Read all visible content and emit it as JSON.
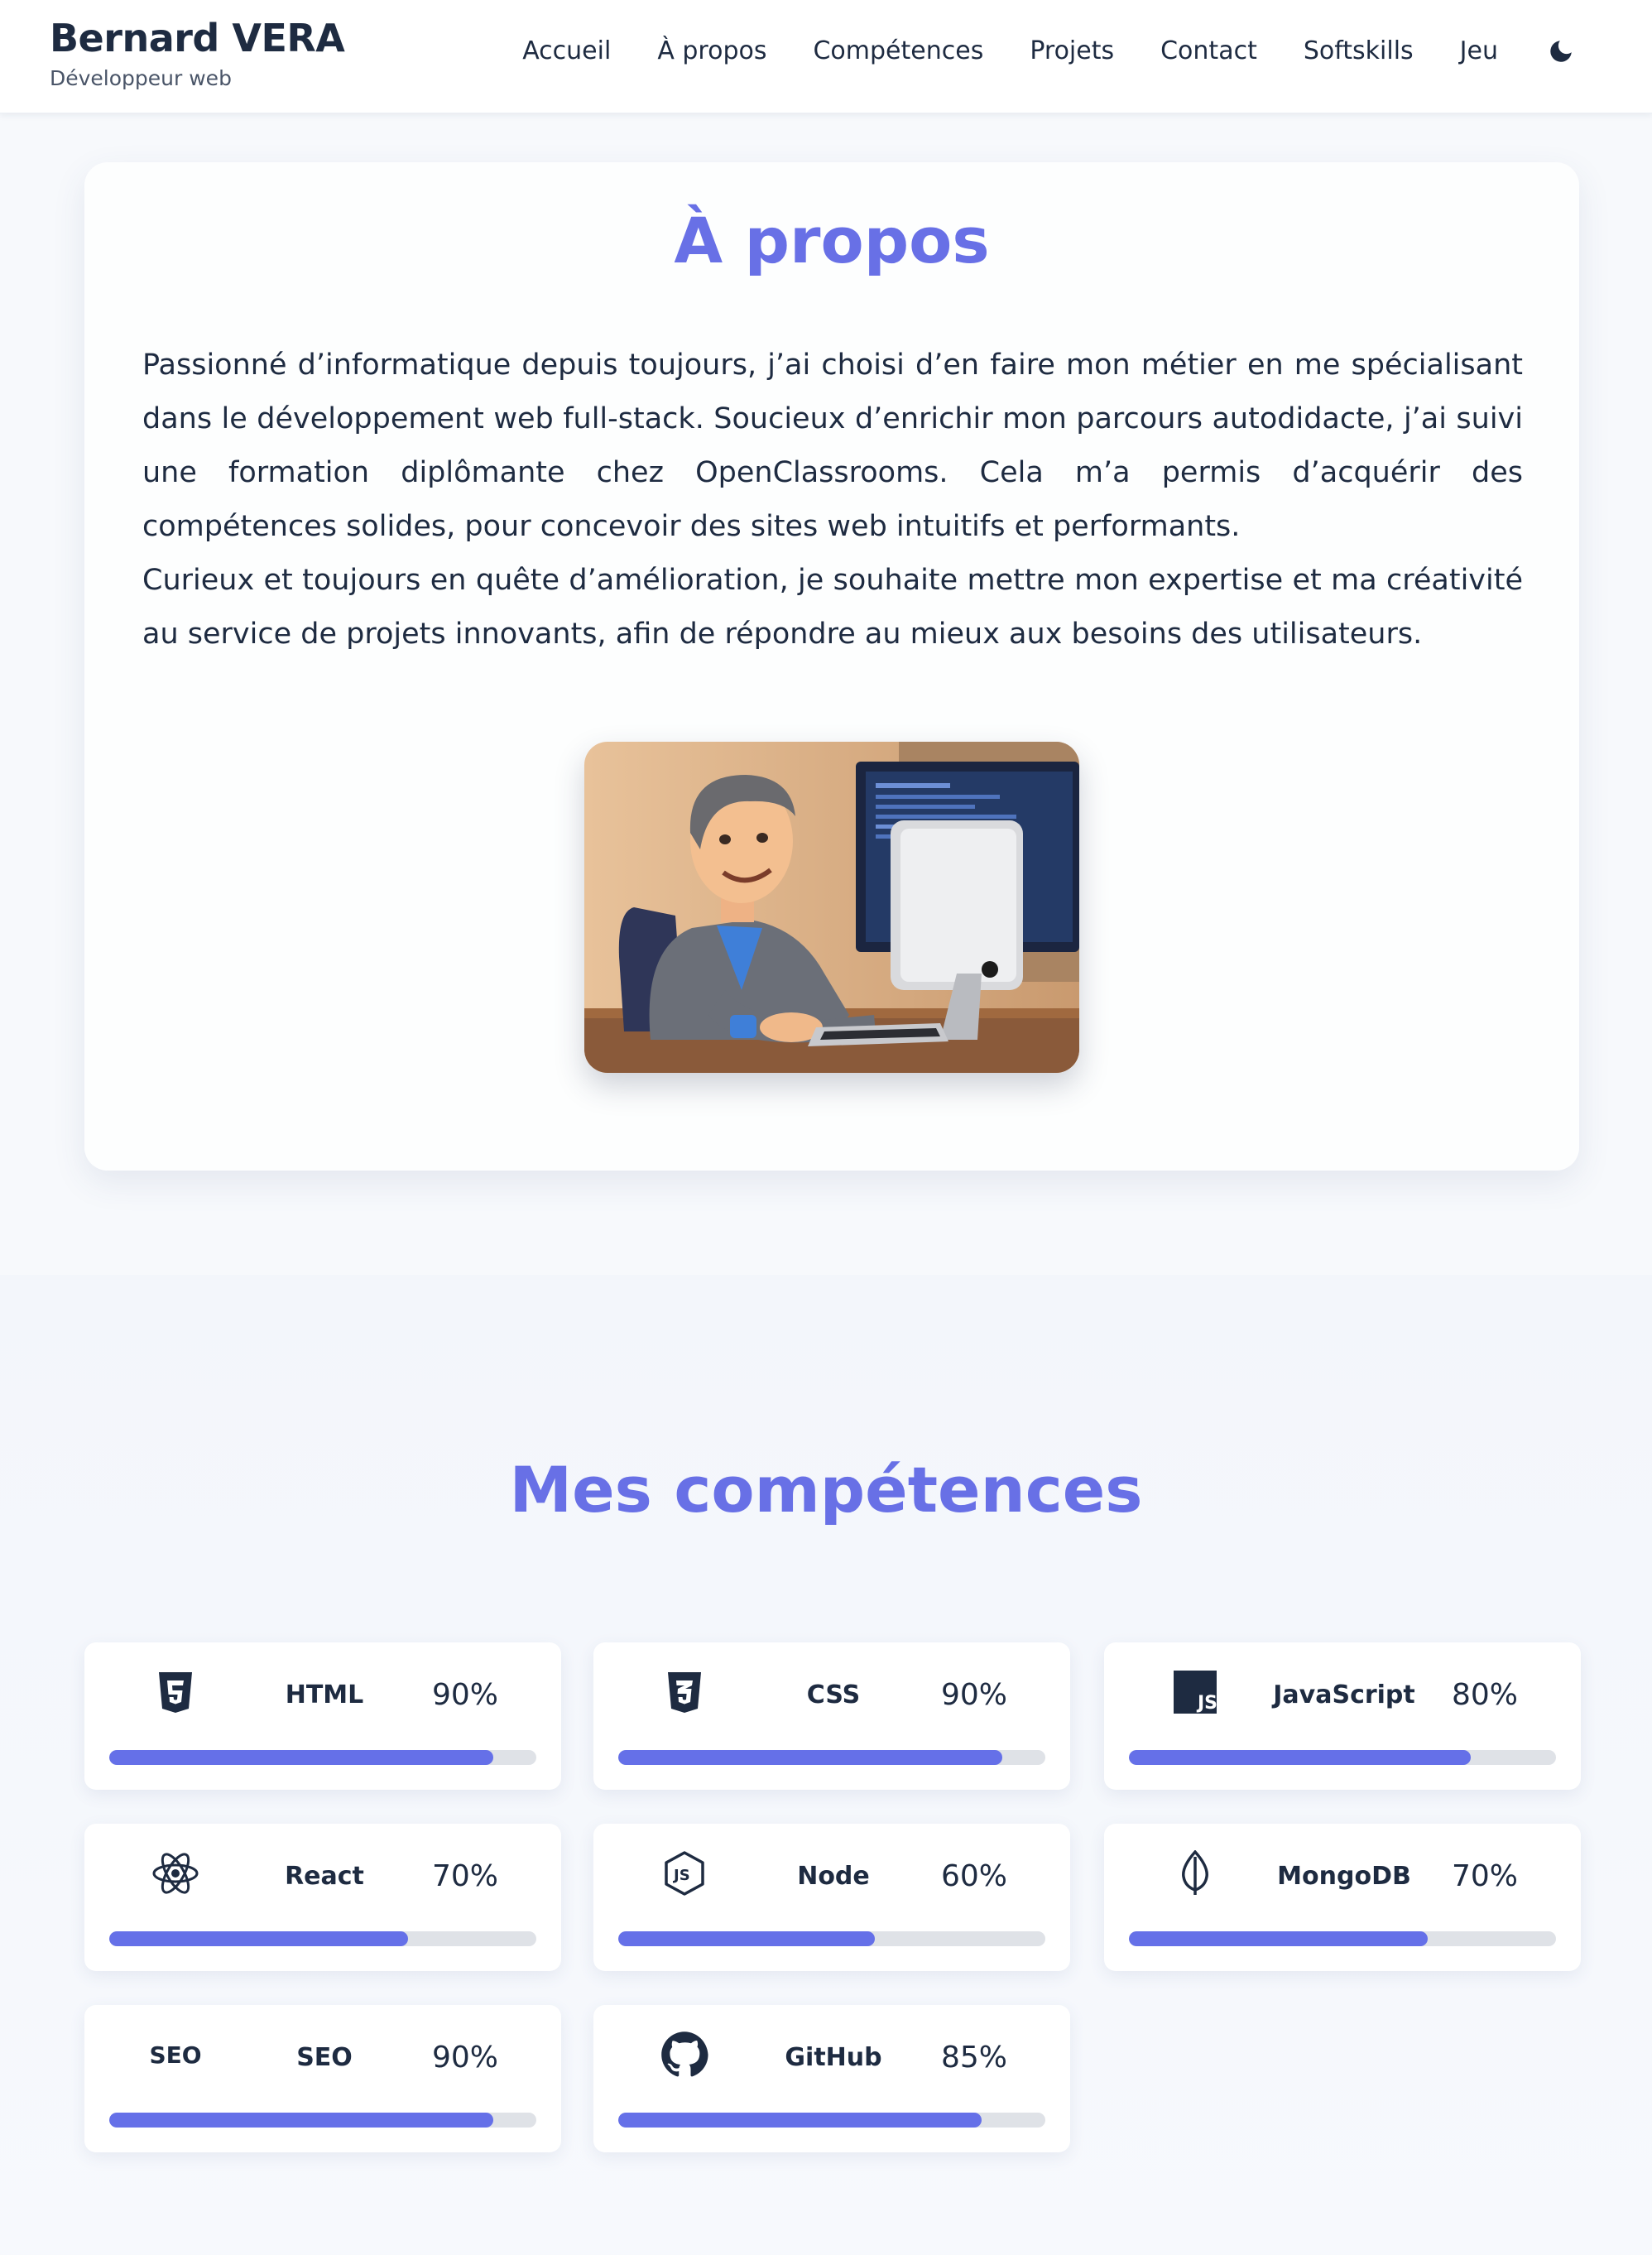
{
  "header": {
    "brand_name": "Bernard VERA",
    "brand_subtitle": "Développeur web",
    "nav": [
      "Accueil",
      "À propos",
      "Compétences",
      "Projets",
      "Contact",
      "Softskills",
      "Jeu"
    ],
    "theme_toggle_icon": "moon-icon"
  },
  "about": {
    "title": "À propos",
    "paragraphs": [
      "Passionné d’informatique depuis toujours, j’ai choisi d’en faire mon métier en me spécialisant dans le développement web full-stack. Soucieux d’enrichir mon parcours autodidacte, j’ai suivi une formation diplômante chez OpenClassrooms. Cela m’a permis d’acquérir des compétences solides, pour concevoir des sites web intuitifs et performants.",
      "Curieux et toujours en quête d’amélioration, je souhaite mettre mon expertise et ma créativité au service de projets innovants, afin de répondre au mieux aux besoins des utilisateurs."
    ],
    "portrait_icon": "developer-portrait-illustration"
  },
  "skills": {
    "title": "Mes compétences",
    "items": [
      {
        "name": "HTML",
        "percent_label": "90%",
        "level": 90,
        "icon": "html5-icon"
      },
      {
        "name": "CSS",
        "percent_label": "90%",
        "level": 90,
        "icon": "css3-icon"
      },
      {
        "name": "JavaScript",
        "percent_label": "80%",
        "level": 80,
        "icon": "javascript-icon"
      },
      {
        "name": "React",
        "percent_label": "70%",
        "level": 70,
        "icon": "react-icon"
      },
      {
        "name": "Node",
        "percent_label": "60%",
        "level": 60,
        "icon": "nodejs-icon"
      },
      {
        "name": "MongoDB",
        "percent_label": "70%",
        "level": 70,
        "icon": "mongodb-icon"
      },
      {
        "name": "SEO",
        "percent_label": "90%",
        "level": 90,
        "icon": "seo-icon",
        "icon_text": "SEO"
      },
      {
        "name": "GitHub",
        "percent_label": "85%",
        "level": 85,
        "icon": "github-icon"
      }
    ]
  },
  "colors": {
    "accent": "#6870e6",
    "bar_fill": "#6570e8",
    "bar_track": "#dfe2e7",
    "text_dark": "#1e2b41"
  }
}
